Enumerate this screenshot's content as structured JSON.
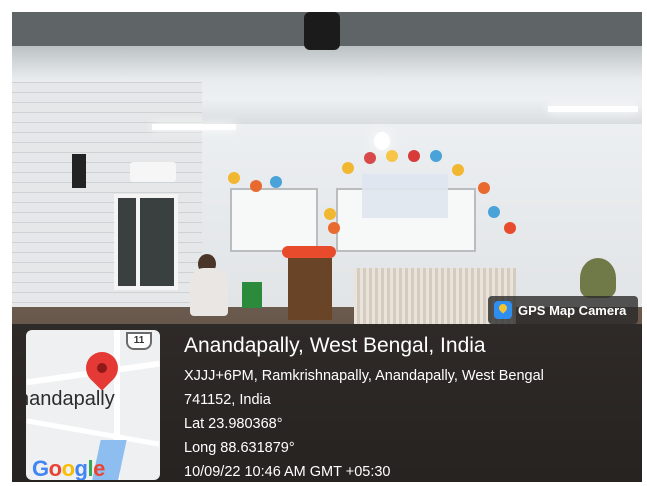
{
  "gps_badge": {
    "label": "GPS Map Camera",
    "icon": "gps-map-camera-icon"
  },
  "map_thumbnail": {
    "place_text": "nandapally",
    "road_shield": "11",
    "brand": "Google",
    "pin_icon": "map-pin-icon",
    "pin_color": "#e53935"
  },
  "location": {
    "title": "Anandapally, West Bengal, India",
    "address_line1": "XJJJ+6PM, Ramkrishnapally, Anandapally, West Bengal",
    "address_line2": "741152, India",
    "lat": "Lat 23.980368°",
    "long": "Long 88.631879°",
    "timestamp": "10/09/22 10:46 AM GMT +05:30"
  }
}
